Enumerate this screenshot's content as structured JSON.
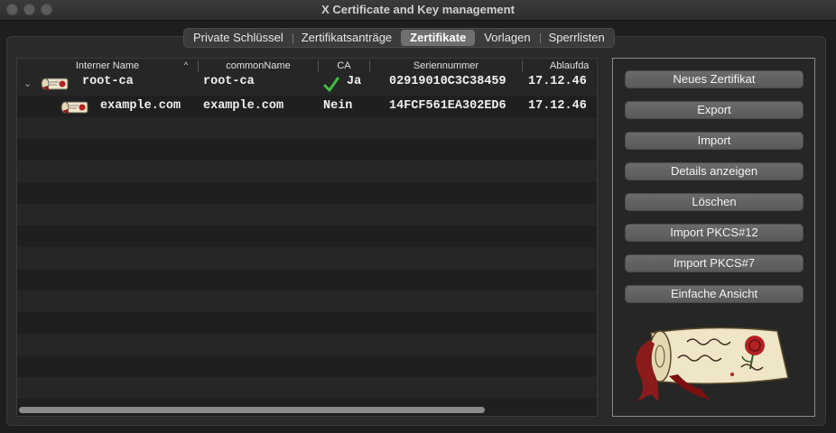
{
  "window": {
    "title": "X Certificate and Key management"
  },
  "tabs": [
    {
      "label": "Private Schlüssel",
      "active": false
    },
    {
      "label": "Zertifikatsanträge",
      "active": false
    },
    {
      "label": "Zertifikate",
      "active": true
    },
    {
      "label": "Vorlagen",
      "active": false
    },
    {
      "label": "Sperrlisten",
      "active": false
    }
  ],
  "table": {
    "headers": [
      "Interner Name",
      "commonName",
      "CA",
      "Seriennummer",
      "Ablaufda"
    ],
    "sort_indicator": "^",
    "rows": [
      {
        "internal_name": "root-ca",
        "common_name": "root-ca",
        "ca": "Ja",
        "ca_check": true,
        "serial": "02919010C3C38459",
        "expiry": "17.12.46",
        "expandable": true
      },
      {
        "internal_name": "example.com",
        "common_name": "example.com",
        "ca": "Nein",
        "ca_check": false,
        "serial": "14FCF561EA302ED6",
        "expiry": "17.12.46",
        "expandable": false
      }
    ]
  },
  "buttons": {
    "new_cert": "Neues Zertifikat",
    "export": "Export",
    "import": "Import",
    "details": "Details anzeigen",
    "delete": "Löschen",
    "import_pkcs12": "Import PKCS#12",
    "import_pkcs7": "Import PKCS#7",
    "simple_view": "Einfache Ansicht"
  },
  "colors": {
    "check": "#3fbf3f",
    "scroll_red": "#8b1a1a",
    "scroll_paper": "#efe6c8"
  },
  "icons": {
    "expand": "chevron-down-icon",
    "certificate": "certificate-scroll-icon",
    "logo": "xca-scroll-logo"
  }
}
